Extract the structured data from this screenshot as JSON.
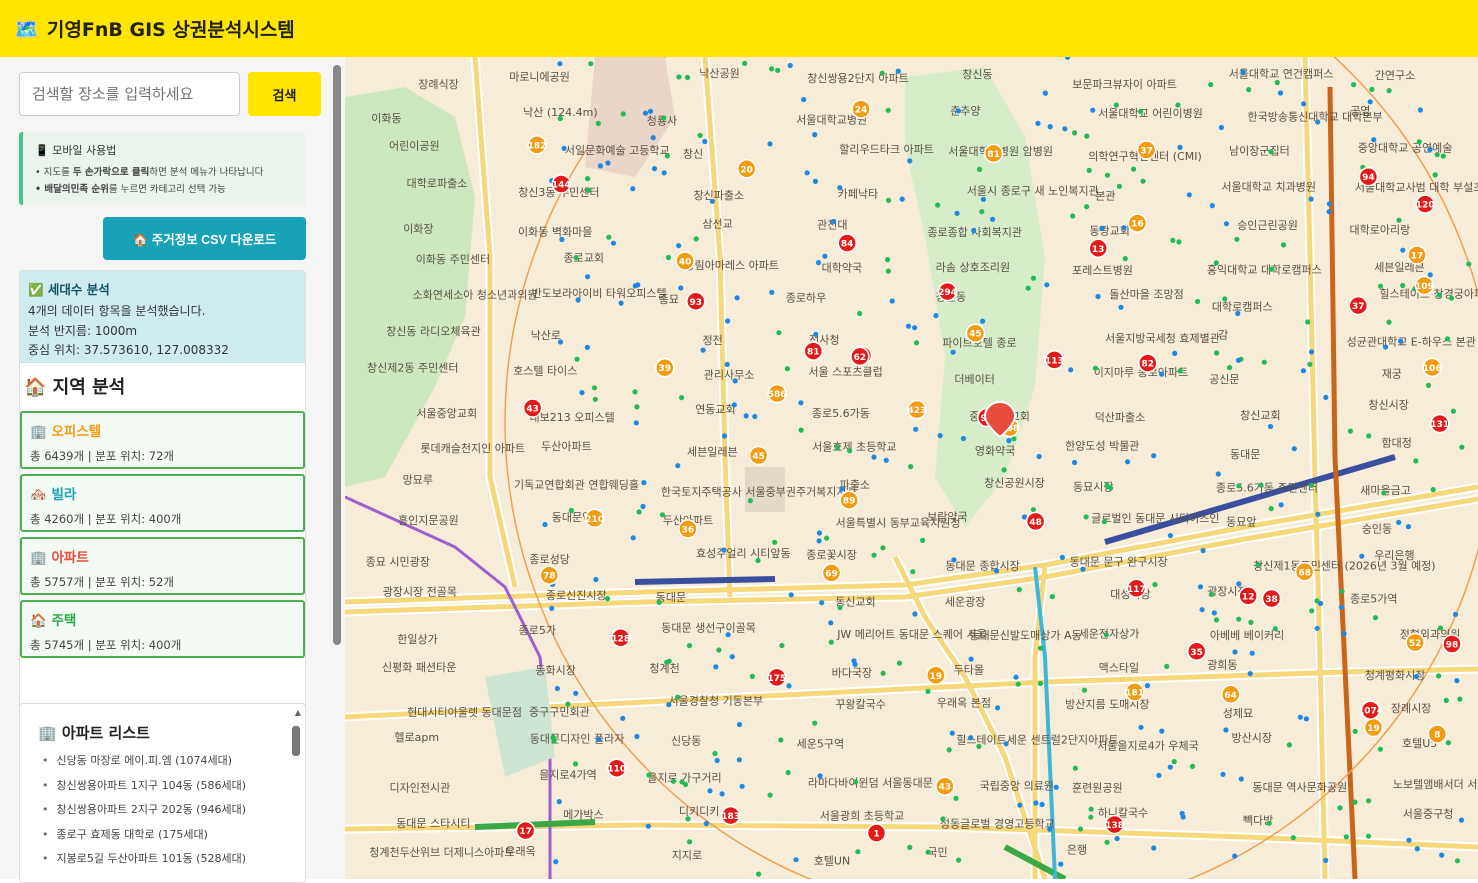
{
  "header": {
    "icon": "map-icon",
    "title": "기영FnB GIS 상권분석시스템"
  },
  "search": {
    "placeholder": "검색할 장소를 입력하세요",
    "button": "검색"
  },
  "mobile_help": {
    "title": "📱 모바일 사용법",
    "line1_pre": "• 지도를 ",
    "line1_bold": "두 손가락으로 클릭",
    "line1_post": "하면 분석 메뉴가 나타납니다",
    "line2_bold": "• 배달의민족 순위",
    "line2_post": "를 누르면 카테고리 선택 가능"
  },
  "csv_button": "🏠 주거정보 CSV 다운로드",
  "household": {
    "title": "✅ 세대수 분석",
    "line1": "4개의 데이터 항목을 분석했습니다.",
    "line2": "분석 반지름: 1000m",
    "line3": "중심 위치: 37.573610, 127.008332"
  },
  "region_title": "🏠 지역 분석",
  "categories": [
    {
      "icon": "🏢",
      "name": "오피스텔",
      "color": "#f39c12",
      "stats": "총 6439개 | 분포 위치: 72개"
    },
    {
      "icon": "🏘️",
      "name": "빌라",
      "color": "#17a2b8",
      "stats": "총 4260개 | 분포 위치: 400개"
    },
    {
      "icon": "🏢",
      "name": "아파트",
      "color": "#e74c3c",
      "stats": "총 5757개 | 분포 위치: 52개"
    },
    {
      "icon": "🏠",
      "name": "주택",
      "color": "#28a745",
      "stats": "총 5745개 | 분포 위치: 400개"
    }
  ],
  "apt_list": {
    "title": "🏢 아파트 리스트",
    "items": [
      "신당동 마장로 에이.피.엠 (1074세대)",
      "창신쌍용아파트 1지구 104동 (586세대)",
      "창신쌍용아파트 2지구 202동 (946세대)",
      "종로구 효제동 대학로 (175세대)",
      "지봉로5길 두산아파트 101동 (528세대)"
    ]
  },
  "map": {
    "labels": [
      "장례식장",
      "마로니에공원",
      "낙산공원",
      "창신쌍용2단지 아파트",
      "창신동",
      "보문파크뷰자이 아파트",
      "서울대학교 연건캠퍼스",
      "간연구소",
      "이화동",
      "낙산 (124.4m)",
      "청룡사",
      "서울대학교병원",
      "춘추양",
      "서울대학교 어린이병원",
      "한국방송통신대학교 대학본부",
      "공영",
      "어린이공원",
      "서일문화예술 고등학교",
      "창신",
      "할리우드타크 아파트",
      "서울대학교병원 암병원",
      "의학연구혁신센터 (CMI)",
      "남이장군집터",
      "중앙대학교 공연예술",
      "대학로파출소",
      "창신3동 주민센터",
      "창신파출소",
      "카페낙타",
      "서울시 종로구 새 노인복지관",
      "본관",
      "서울대학교 치과병원",
      "서울대학교사범 대학 부설초등학교",
      "이화장",
      "이화동 벽화마을",
      "삼선교",
      "관천대",
      "종로종합 사회복지관",
      "동광교회",
      "승인근린공원",
      "대학로아리랑",
      "이화동 주민센터",
      "종로교회",
      "동림아마레스 아파트",
      "대학약국",
      "라솜 상호조리원",
      "포레스트병원",
      "홍익대학교 대학로캠퍼스",
      "세븐일레븐",
      "소화연세소아 청소년과의원",
      "반도보라아이비 타워오피스텔",
      "종묘",
      "종로하우",
      "창신동",
      "돌산마을 조망점",
      "대학로캠퍼스",
      "힐스테이트 창경궁아파트",
      "창신동 라디오체육관",
      "낙산로",
      "정전",
      "전사청",
      "파이브호텔 종로",
      "서울지방국세청 효제별관",
      "감",
      "성균관대학교 E-하우스 본관",
      "창신제2동 주민센터",
      "호스텔 타이스",
      "관리사무소",
      "서울 스포츠클럽",
      "더베이터",
      "이지마루 종로아파트",
      "공신문",
      "재궁",
      "서울중앙교회",
      "대보213 오피스텔",
      "연동교회",
      "종로5.6가동",
      "중앙성결교회",
      "덕산파출소",
      "창신교회",
      "창신시장",
      "롯데캐슬천지인 아파트",
      "두산아파트",
      "세븐일레븐",
      "서울효제 초등학교",
      "영화약국",
      "한양도성 박물관",
      "동대문",
      "함대정",
      "망묘루",
      "기독교연합회관 연합웨딩홀",
      "한국토지주택공사 서울중부권주거복지지사",
      "파출소",
      "창신공원시장",
      "동묘시장",
      "종로5.6가동 주민센터",
      "새마을금고",
      "흥인지문공원",
      "동대문역",
      "두산아파트",
      "서울특별시 동부교육지원청",
      "보람약국",
      "글로벌인 동대문 시티이즈인",
      "동묘앞",
      "숭인동",
      "종묘 시민광장",
      "종로성당",
      "효성주얼리 시티앞동",
      "종로꽃시장",
      "동대문 종합시장",
      "동대문 문구 완구시장",
      "창신제1동주민센터 (2026년 3월 예정)",
      "우리은행",
      "광장시장 전골목",
      "종로신진시장",
      "동대문",
      "동신교회",
      "세운광장",
      "대성식당",
      "광장시장",
      "종로5가역",
      "한일상가",
      "종로5가",
      "동대문 생선구이골목",
      "JW 메리어트 동대문 스퀘어 서울",
      "동대문신발도매상가 A동",
      "세운전자상가",
      "아베베 베이커리",
      "정형외과의원",
      "신평화 패션타운",
      "동화시장",
      "청계천",
      "바다국장",
      "두타몰",
      "맥스타일",
      "광희동",
      "청계평화시장",
      "현대시티아울렛 동대문점",
      "중구구민회관",
      "서울경찰청 기동본부",
      "꾸왕칼국수",
      "우래옥 본점",
      "방산지름 도매시장",
      "성제묘",
      "장례시장",
      "헬로apm",
      "동대문디자인 플라자",
      "신당동",
      "세운5구역",
      "힐스테이트세운 센트럴2단지아파트",
      "서울을지로4가 우체국",
      "방산시장",
      "호텔U5",
      "디자인전시관",
      "을지로4가역",
      "을지로 가구거리",
      "라마다바이윈덤 서울동대문",
      "국립중앙 의료원",
      "훈련원공원",
      "동대문 역사문화공원",
      "노보텔앰배서더 서울 동대문",
      "동대문 스타시티",
      "메가박스",
      "디키디키",
      "서울광희 초등학교",
      "성동글로벌 경영고등학교",
      "하니칼국수",
      "빽다방",
      "서울중구청",
      "청계천두산위브 더제니스아파트",
      "우래옥",
      "지지로",
      "호텔UN",
      "국민",
      "은행"
    ]
  }
}
